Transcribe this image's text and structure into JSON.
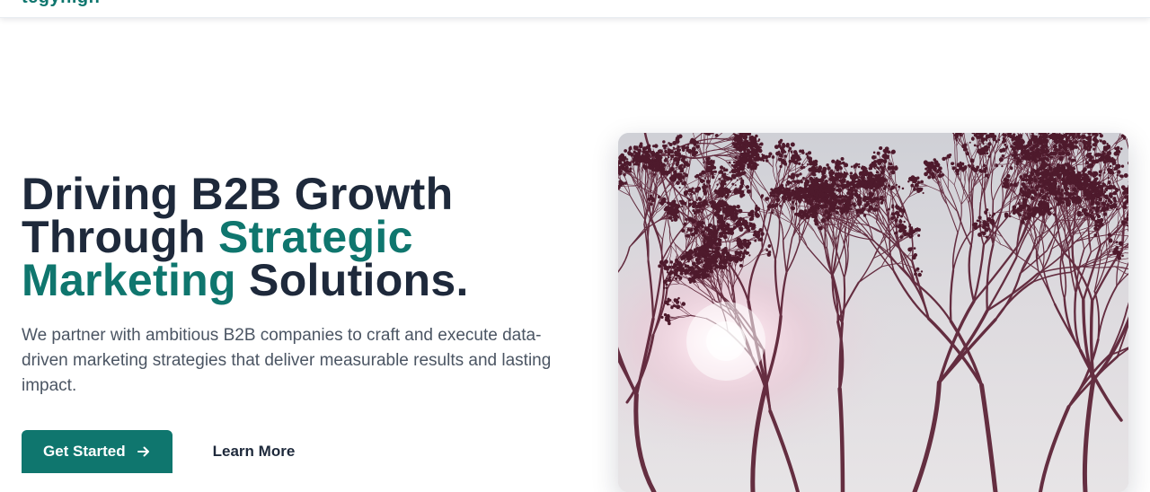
{
  "header": {
    "logo_text": "tegyhigh"
  },
  "hero": {
    "headline_part1": "Driving B2B Growth Through ",
    "headline_accent": "Strategic Marketing",
    "headline_part2": " Solutions.",
    "lead": "We partner with ambitious B2B companies to craft and execute data-driven marketing strategies that deliver measurable results and lasting impact.",
    "cta_primary": "Get Started",
    "cta_secondary": "Learn More",
    "image_subject": "bare tree branches against a bright hazy sky"
  },
  "colors": {
    "accent": "#0f766e",
    "heading": "#1e293b",
    "body_text": "#4b5563",
    "button_text": "#ffffff"
  },
  "icons": {
    "primary_button_icon": "arrow-right-icon"
  }
}
